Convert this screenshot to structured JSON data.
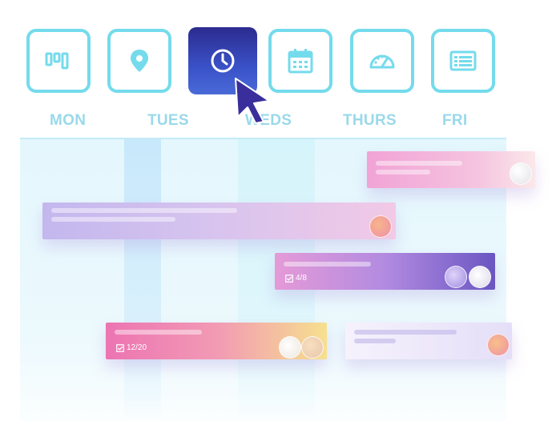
{
  "toolbar": {
    "views": [
      {
        "icon": "board-columns-icon"
      },
      {
        "icon": "map-pin-icon"
      },
      {
        "icon": "clock-icon"
      },
      {
        "icon": "calendar-icon"
      },
      {
        "icon": "speedometer-icon"
      },
      {
        "icon": "table-list-icon"
      }
    ]
  },
  "days": [
    "MON",
    "TUES",
    "WEDS",
    "THURS",
    "FRI"
  ],
  "cards": [
    {
      "checklist": ""
    },
    {
      "checklist": ""
    },
    {
      "checklist": "4/8"
    },
    {
      "checklist": "12/20"
    },
    {
      "checklist": ""
    }
  ],
  "colors": {
    "accent": "#74dbec",
    "active_view": "#2c2b8f",
    "day_label": "#9ad9ea"
  }
}
